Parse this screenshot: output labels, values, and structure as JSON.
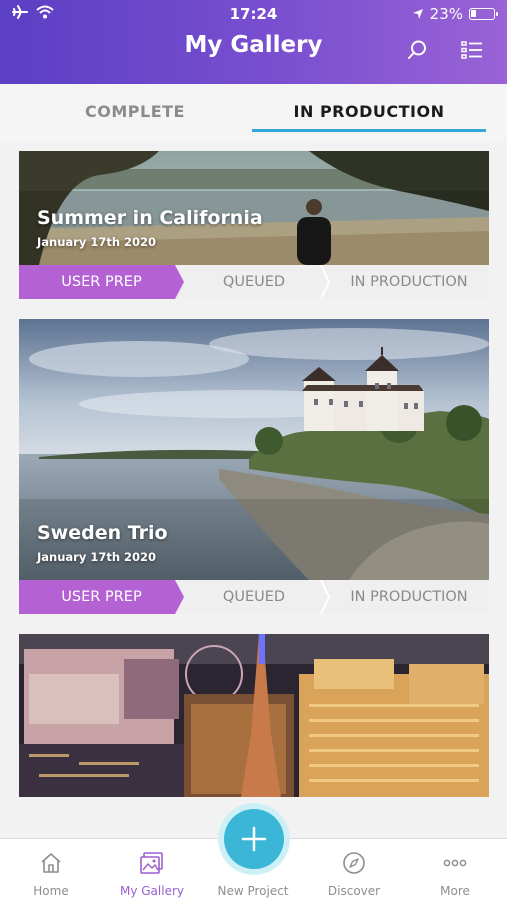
{
  "status": {
    "time": "17:24",
    "battery": "23%"
  },
  "header": {
    "title": "My Gallery"
  },
  "tabs": [
    {
      "label": "COMPLETE",
      "active": false
    },
    {
      "label": "IN PRODUCTION",
      "active": true
    }
  ],
  "projects": [
    {
      "name": "Summer in California",
      "date": "January 17th 2020",
      "steps": [
        "USER PREP",
        "QUEUED",
        "IN PRODUCTION"
      ],
      "active_step": 0
    },
    {
      "name": "Sweden Trio",
      "date": "January 17th 2020",
      "steps": [
        "USER PREP",
        "QUEUED",
        "IN PRODUCTION"
      ],
      "active_step": 0
    }
  ],
  "bottom_nav": [
    {
      "label": "Home",
      "icon": "home-icon"
    },
    {
      "label": "My Gallery",
      "icon": "gallery-icon",
      "active": true
    },
    {
      "label": "New Project",
      "icon": "plus-icon"
    },
    {
      "label": "Discover",
      "icon": "compass-icon"
    },
    {
      "label": "More",
      "icon": "more-icon"
    }
  ],
  "colors": {
    "header_start": "#5b3fc4",
    "header_end": "#9a63d6",
    "tab_underline": "#33a8d6",
    "step_active": "#b462d3",
    "fab": "#3bb6d6",
    "nav_active": "#9b5fd0"
  }
}
